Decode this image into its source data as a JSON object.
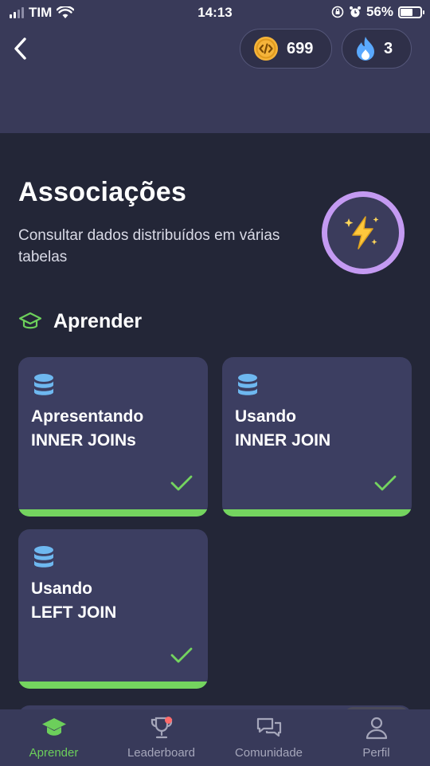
{
  "status": {
    "carrier": "TIM",
    "time": "14:13",
    "battery": "56%",
    "battery_level": 0.56
  },
  "header": {
    "coins": "699",
    "streak": "3"
  },
  "lesson": {
    "title": "Associações",
    "subtitle": "Consultar dados distribuídos em várias tabelas"
  },
  "section": {
    "label": "Aprender"
  },
  "cards": [
    {
      "line1": "Apresentando",
      "line2": "INNER JOINs",
      "completed": true
    },
    {
      "line1": "Usando",
      "line2": "INNER JOIN",
      "completed": true
    },
    {
      "line1": "Usando",
      "line2": "LEFT JOIN",
      "completed": true
    }
  ],
  "tabs": [
    {
      "label": "Aprender",
      "icon": "graduation-cap-icon",
      "active": true
    },
    {
      "label": "Leaderboard",
      "icon": "trophy-icon",
      "active": false
    },
    {
      "label": "Comunidade",
      "icon": "chat-bubbles-icon",
      "active": false
    },
    {
      "label": "Perfil",
      "icon": "person-icon",
      "active": false
    }
  ],
  "colors": {
    "accent_green": "#74d45f",
    "badge_purple": "#c49af2",
    "coin_gold": "#f5b43a",
    "flame_blue": "#5aa9ff"
  }
}
